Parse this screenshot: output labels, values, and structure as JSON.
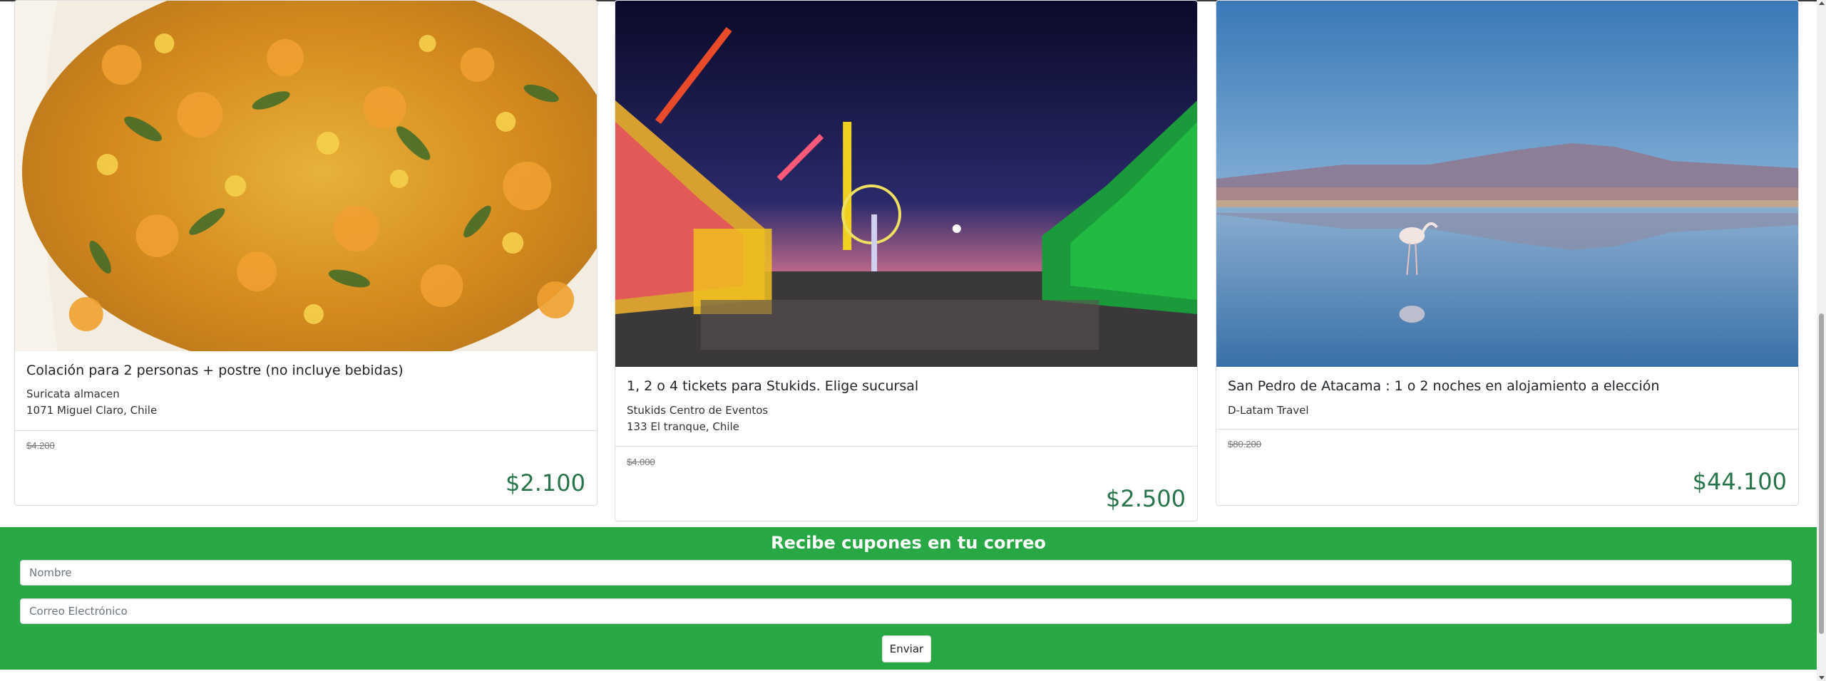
{
  "cards": [
    {
      "image": "food-dish-image",
      "title": "Colación para 2 personas + postre (no incluye bebidas)",
      "merchant": "Suricata almacen",
      "address": "1071 Miguel Claro, Chile",
      "old_price": "$4.200",
      "new_price": "$2.100"
    },
    {
      "image": "amusement-park-image",
      "title": "1, 2 o 4 tickets para Stukids. Elige sucursal",
      "merchant": "Stukids Centro de Eventos",
      "address": "133 El tranque, Chile",
      "old_price": "$4.000",
      "new_price": "$2.500"
    },
    {
      "image": "flamingo-lake-image",
      "title": "San Pedro de Atacama : 1 o 2 noches en alojamiento a elección",
      "merchant": "D-Latam Travel",
      "old_price": "$80.200",
      "new_price": "$44.100"
    }
  ],
  "newsletter": {
    "title": "Recibe cupones en tu correo",
    "name_placeholder": "Nombre",
    "email_placeholder": "Correo Electrónico",
    "submit_label": "Enviar"
  },
  "colors": {
    "newsletter_bg": "#28a745",
    "price_green": "#28744a"
  }
}
